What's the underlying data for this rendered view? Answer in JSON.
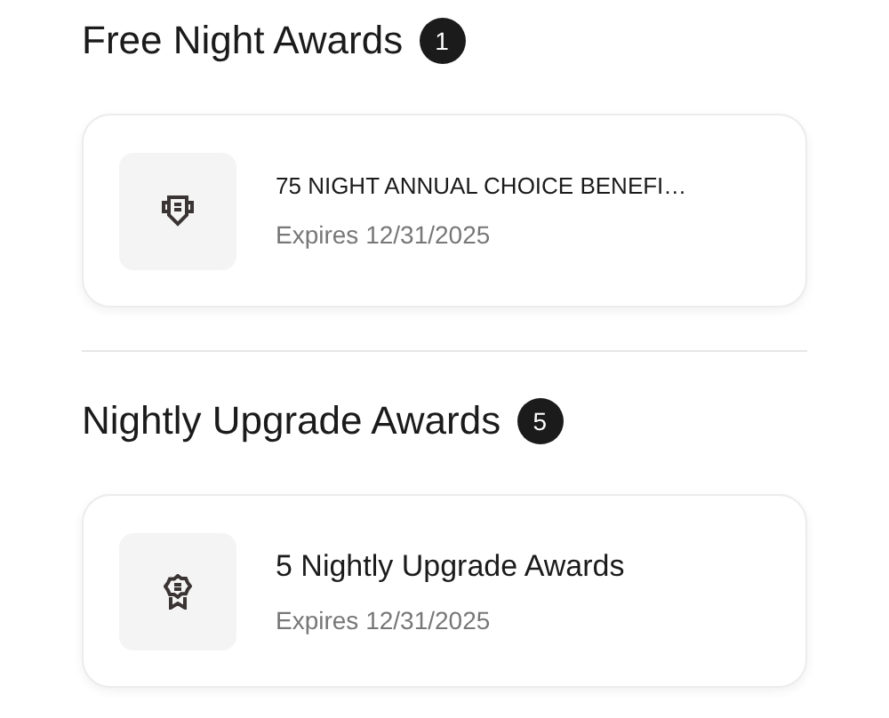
{
  "sections": [
    {
      "title": "Free Night Awards",
      "count": "1",
      "awards": [
        {
          "kind": "shield",
          "name": "75 NIGHT ANNUAL CHOICE BENEFI…",
          "expiry": "Expires 12/31/2025"
        }
      ]
    },
    {
      "title": "Nightly Upgrade Awards",
      "count": "5",
      "awards": [
        {
          "kind": "rosette",
          "name": "5 Nightly Upgrade Awards",
          "expiry": "Expires 12/31/2025"
        }
      ]
    }
  ]
}
